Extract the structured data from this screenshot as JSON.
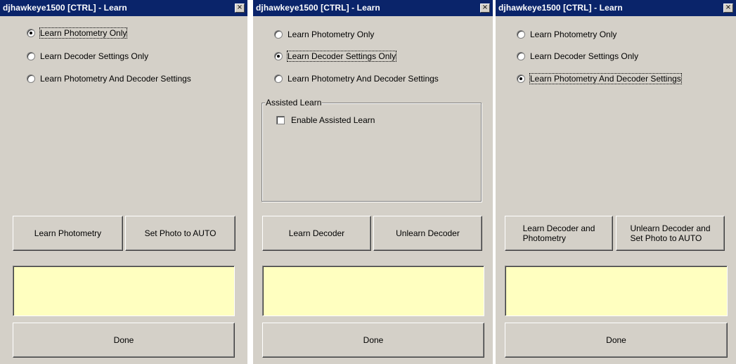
{
  "windows": [
    {
      "title": "djhawkeye1500 [CTRL] - Learn",
      "close_glyph": "×",
      "options": [
        {
          "label": "Learn Photometry Only",
          "checked": true
        },
        {
          "label": "Learn Decoder Settings Only",
          "checked": false
        },
        {
          "label": "Learn Photometry And Decoder Settings",
          "checked": false
        }
      ],
      "buttons": [
        "Learn Photometry",
        "Set Photo to AUTO"
      ],
      "status_text": "",
      "done_label": "Done"
    },
    {
      "title": "djhawkeye1500 [CTRL] - Learn",
      "close_glyph": "×",
      "options": [
        {
          "label": "Learn Photometry Only",
          "checked": false
        },
        {
          "label": "Learn Decoder Settings Only",
          "checked": true
        },
        {
          "label": "Learn Photometry And Decoder Settings",
          "checked": false
        }
      ],
      "assisted": {
        "group_title": "Assisted Learn",
        "checkbox_label": "Enable Assisted Learn",
        "checked": false
      },
      "buttons": [
        "Learn Decoder",
        "Unlearn Decoder"
      ],
      "status_text": "",
      "done_label": "Done"
    },
    {
      "title": "djhawkeye1500 [CTRL] - Learn",
      "close_glyph": "×",
      "options": [
        {
          "label": "Learn Photometry Only",
          "checked": false
        },
        {
          "label": "Learn Decoder Settings Only",
          "checked": false
        },
        {
          "label": "Learn Photometry And Decoder Settings",
          "checked": true
        }
      ],
      "buttons": [
        {
          "line1": "Learn Decoder and",
          "line2": "Photometry"
        },
        {
          "line1": "Unlearn Decoder and",
          "line2": "Set Photo to AUTO"
        }
      ],
      "status_text": "",
      "done_label": "Done"
    }
  ],
  "colors": {
    "titlebar": "#0a246a",
    "face": "#d4d0c8",
    "status_bg": "#ffffc0"
  }
}
